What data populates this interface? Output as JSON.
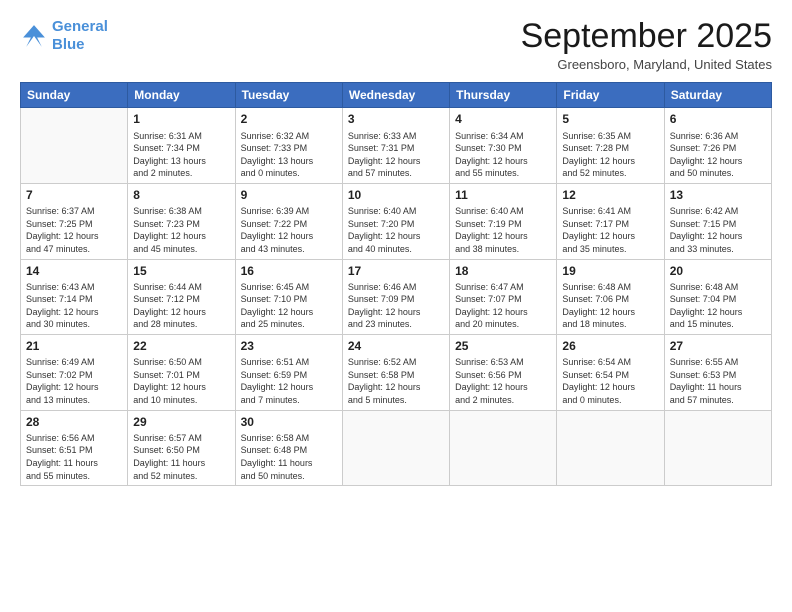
{
  "header": {
    "logo_line1": "General",
    "logo_line2": "Blue",
    "month": "September 2025",
    "location": "Greensboro, Maryland, United States"
  },
  "weekdays": [
    "Sunday",
    "Monday",
    "Tuesday",
    "Wednesday",
    "Thursday",
    "Friday",
    "Saturday"
  ],
  "weeks": [
    [
      {
        "day": "",
        "info": ""
      },
      {
        "day": "1",
        "info": "Sunrise: 6:31 AM\nSunset: 7:34 PM\nDaylight: 13 hours\nand 2 minutes."
      },
      {
        "day": "2",
        "info": "Sunrise: 6:32 AM\nSunset: 7:33 PM\nDaylight: 13 hours\nand 0 minutes."
      },
      {
        "day": "3",
        "info": "Sunrise: 6:33 AM\nSunset: 7:31 PM\nDaylight: 12 hours\nand 57 minutes."
      },
      {
        "day": "4",
        "info": "Sunrise: 6:34 AM\nSunset: 7:30 PM\nDaylight: 12 hours\nand 55 minutes."
      },
      {
        "day": "5",
        "info": "Sunrise: 6:35 AM\nSunset: 7:28 PM\nDaylight: 12 hours\nand 52 minutes."
      },
      {
        "day": "6",
        "info": "Sunrise: 6:36 AM\nSunset: 7:26 PM\nDaylight: 12 hours\nand 50 minutes."
      }
    ],
    [
      {
        "day": "7",
        "info": "Sunrise: 6:37 AM\nSunset: 7:25 PM\nDaylight: 12 hours\nand 47 minutes."
      },
      {
        "day": "8",
        "info": "Sunrise: 6:38 AM\nSunset: 7:23 PM\nDaylight: 12 hours\nand 45 minutes."
      },
      {
        "day": "9",
        "info": "Sunrise: 6:39 AM\nSunset: 7:22 PM\nDaylight: 12 hours\nand 43 minutes."
      },
      {
        "day": "10",
        "info": "Sunrise: 6:40 AM\nSunset: 7:20 PM\nDaylight: 12 hours\nand 40 minutes."
      },
      {
        "day": "11",
        "info": "Sunrise: 6:40 AM\nSunset: 7:19 PM\nDaylight: 12 hours\nand 38 minutes."
      },
      {
        "day": "12",
        "info": "Sunrise: 6:41 AM\nSunset: 7:17 PM\nDaylight: 12 hours\nand 35 minutes."
      },
      {
        "day": "13",
        "info": "Sunrise: 6:42 AM\nSunset: 7:15 PM\nDaylight: 12 hours\nand 33 minutes."
      }
    ],
    [
      {
        "day": "14",
        "info": "Sunrise: 6:43 AM\nSunset: 7:14 PM\nDaylight: 12 hours\nand 30 minutes."
      },
      {
        "day": "15",
        "info": "Sunrise: 6:44 AM\nSunset: 7:12 PM\nDaylight: 12 hours\nand 28 minutes."
      },
      {
        "day": "16",
        "info": "Sunrise: 6:45 AM\nSunset: 7:10 PM\nDaylight: 12 hours\nand 25 minutes."
      },
      {
        "day": "17",
        "info": "Sunrise: 6:46 AM\nSunset: 7:09 PM\nDaylight: 12 hours\nand 23 minutes."
      },
      {
        "day": "18",
        "info": "Sunrise: 6:47 AM\nSunset: 7:07 PM\nDaylight: 12 hours\nand 20 minutes."
      },
      {
        "day": "19",
        "info": "Sunrise: 6:48 AM\nSunset: 7:06 PM\nDaylight: 12 hours\nand 18 minutes."
      },
      {
        "day": "20",
        "info": "Sunrise: 6:48 AM\nSunset: 7:04 PM\nDaylight: 12 hours\nand 15 minutes."
      }
    ],
    [
      {
        "day": "21",
        "info": "Sunrise: 6:49 AM\nSunset: 7:02 PM\nDaylight: 12 hours\nand 13 minutes."
      },
      {
        "day": "22",
        "info": "Sunrise: 6:50 AM\nSunset: 7:01 PM\nDaylight: 12 hours\nand 10 minutes."
      },
      {
        "day": "23",
        "info": "Sunrise: 6:51 AM\nSunset: 6:59 PM\nDaylight: 12 hours\nand 7 minutes."
      },
      {
        "day": "24",
        "info": "Sunrise: 6:52 AM\nSunset: 6:58 PM\nDaylight: 12 hours\nand 5 minutes."
      },
      {
        "day": "25",
        "info": "Sunrise: 6:53 AM\nSunset: 6:56 PM\nDaylight: 12 hours\nand 2 minutes."
      },
      {
        "day": "26",
        "info": "Sunrise: 6:54 AM\nSunset: 6:54 PM\nDaylight: 12 hours\nand 0 minutes."
      },
      {
        "day": "27",
        "info": "Sunrise: 6:55 AM\nSunset: 6:53 PM\nDaylight: 11 hours\nand 57 minutes."
      }
    ],
    [
      {
        "day": "28",
        "info": "Sunrise: 6:56 AM\nSunset: 6:51 PM\nDaylight: 11 hours\nand 55 minutes."
      },
      {
        "day": "29",
        "info": "Sunrise: 6:57 AM\nSunset: 6:50 PM\nDaylight: 11 hours\nand 52 minutes."
      },
      {
        "day": "30",
        "info": "Sunrise: 6:58 AM\nSunset: 6:48 PM\nDaylight: 11 hours\nand 50 minutes."
      },
      {
        "day": "",
        "info": ""
      },
      {
        "day": "",
        "info": ""
      },
      {
        "day": "",
        "info": ""
      },
      {
        "day": "",
        "info": ""
      }
    ]
  ]
}
